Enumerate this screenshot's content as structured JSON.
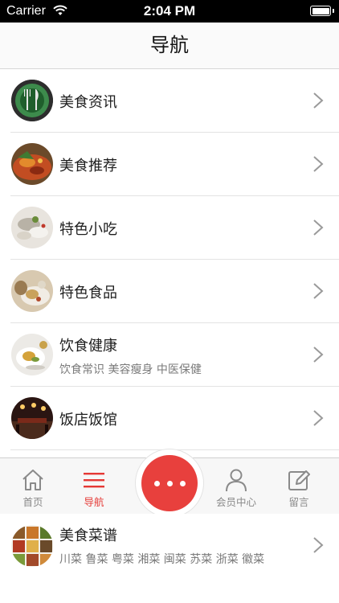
{
  "status_bar": {
    "carrier": "Carrier",
    "time": "2:04 PM"
  },
  "header": {
    "title": "导航"
  },
  "menu": [
    {
      "title": "美食资讯",
      "subtitle": "",
      "thumb_icon": "fork-knife-plate-icon"
    },
    {
      "title": "美食推荐",
      "subtitle": "",
      "thumb_icon": "dish-photo-icon"
    },
    {
      "title": "特色小吃",
      "subtitle": "",
      "thumb_icon": "dumplings-photo-icon"
    },
    {
      "title": "特色食品",
      "subtitle": "",
      "thumb_icon": "food-photo-icon"
    },
    {
      "title": "饮食健康",
      "subtitle": "饮食常识  美容瘦身  中医保健",
      "thumb_icon": "salad-photo-icon"
    },
    {
      "title": "饭店饭馆",
      "subtitle": "",
      "thumb_icon": "restaurant-photo-icon"
    }
  ],
  "tab_bar": {
    "items": [
      {
        "label": "首页",
        "icon": "home-icon",
        "active": false
      },
      {
        "label": "导航",
        "icon": "menu-icon",
        "active": true
      },
      {
        "label": "会员中心",
        "icon": "user-icon",
        "active": false
      },
      {
        "label": "留言",
        "icon": "edit-icon",
        "active": false
      }
    ],
    "center_icon": "more-dots-icon"
  },
  "bottom_partial": {
    "title": "美食菜谱",
    "subtitle": "川菜  鲁菜  粤菜  湘菜  闽菜  苏菜  浙菜  徽菜"
  },
  "colors": {
    "accent": "#e8403d",
    "header_bg": "#fafafa",
    "tab_bg": "#f7f7f7",
    "thumb_ring": "#3a8a4a"
  }
}
